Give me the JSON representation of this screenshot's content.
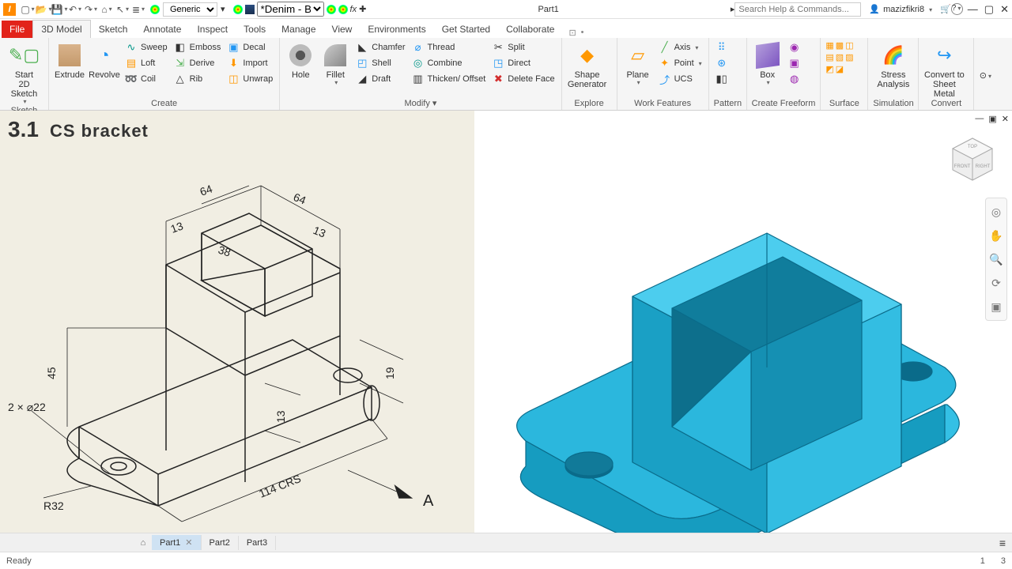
{
  "qat": {
    "doc_title": "Part1"
  },
  "material": {
    "dropdown": "Generic",
    "appearance": "*Denim - B"
  },
  "search": {
    "placeholder": "Search Help & Commands..."
  },
  "user": {
    "name": "mazizfikri8"
  },
  "tabs": {
    "file": "File",
    "items": [
      "3D Model",
      "Sketch",
      "Annotate",
      "Inspect",
      "Tools",
      "Manage",
      "View",
      "Environments",
      "Get Started",
      "Collaborate"
    ],
    "active": 0
  },
  "ribbon": {
    "sketch": {
      "label": "Sketch",
      "start": "Start\n2D Sketch"
    },
    "create": {
      "label": "Create",
      "extrude": "Extrude",
      "revolve": "Revolve",
      "sweep": "Sweep",
      "loft": "Loft",
      "coil": "Coil",
      "emboss": "Emboss",
      "derive": "Derive",
      "rib": "Rib",
      "decal": "Decal",
      "import": "Import",
      "unwrap": "Unwrap"
    },
    "modify": {
      "label": "Modify ▾",
      "hole": "Hole",
      "fillet": "Fillet",
      "chamfer": "Chamfer",
      "shell": "Shell",
      "draft": "Draft",
      "thread": "Thread",
      "combine": "Combine",
      "thicken": "Thicken/ Offset",
      "split": "Split",
      "direct": "Direct",
      "delface": "Delete Face"
    },
    "explore": {
      "label": "Explore",
      "shape": "Shape\nGenerator"
    },
    "work": {
      "label": "Work Features",
      "plane": "Plane",
      "axis": "Axis",
      "point": "Point",
      "ucs": "UCS"
    },
    "pattern": {
      "label": "Pattern"
    },
    "freeform": {
      "label": "Create Freeform",
      "box": "Box"
    },
    "surface": {
      "label": "Surface"
    },
    "simulation": {
      "label": "Simulation",
      "stress": "Stress\nAnalysis"
    },
    "convert": {
      "label": "Convert",
      "sheet": "Convert to\nSheet Metal"
    }
  },
  "drawing": {
    "section": "3.1",
    "title": "CS bracket",
    "dims": {
      "d64a": "64",
      "d64b": "64",
      "d13a": "13",
      "d13b": "13",
      "d38": "38",
      "d45": "45",
      "d19": "19",
      "d13c": "13",
      "crs": "114 CRS",
      "holes": "2 × ⌀22",
      "rad": "R32",
      "view": "A"
    }
  },
  "doctabs": {
    "items": [
      "Part1",
      "Part2",
      "Part3"
    ],
    "active": 0
  },
  "status": {
    "text": "Ready",
    "v1": "1",
    "v2": "3"
  }
}
